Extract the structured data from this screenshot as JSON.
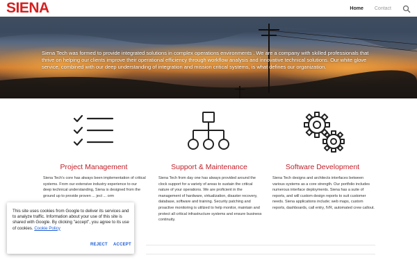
{
  "header": {
    "logo": "SIENA",
    "nav": [
      {
        "label": "Home",
        "active": true
      },
      {
        "label": "Contact",
        "active": false
      }
    ],
    "search_icon": "search-icon"
  },
  "hero": {
    "text": "Siena Tech  was formed to provide integrated solutions in complex operations environments . We are a company with skilled professionals that thrive on helping our clients improve their operational efficiency through workflow analysis and innovative technical solutions. Our white glove service, combined with our deep understanding of integration and mission critical systems, is what defines our organization."
  },
  "columns": [
    {
      "icon": "checklist-icon",
      "title": "Project Management",
      "description": "Siena Tech's core has always been implementation of critical systems.  From our extensive industry experience to our deep technical understanding, Siena is designed from the ground up to provide proven ... ject ... orm"
    },
    {
      "icon": "hierarchy-icon",
      "title": "Support & Maintenance",
      "description": "Siena Tech from day one has always provided around the clock support for a variety of areas to sustain the critical nature of your operations.  We are proficient in the management of hardware, virtualization, disaster recovery, database, software and training.   Security patching and proactive monitoring is utilized to help monitor, maintain and protect all critical infrastructure systems and ensure business continuity."
    },
    {
      "icon": "gears-icon",
      "title": "Software Development",
      "description": "Siena Tech designs and architects interfaces between various systems as a core strength. Our portfolio includes numerous interface deployments.  Siena has a suite of reports, and will custom design reports to suit customer needs. Siena applications include; web maps, custom reports, dashboards, call entry, IVR, automated crew callout."
    }
  ],
  "cookie": {
    "text": "This site uses cookies from Google to deliver its services and to analyze traffic. Information about your use of this site is shared with Google. By clicking \"accept\", you agree to its use of cookies.",
    "link": "Cookie Policy",
    "reject": "REJECT",
    "accept": "ACCEPT"
  },
  "colors": {
    "accent": "#c0202a",
    "logo": "#d4201f",
    "link": "#1a5bd6"
  }
}
